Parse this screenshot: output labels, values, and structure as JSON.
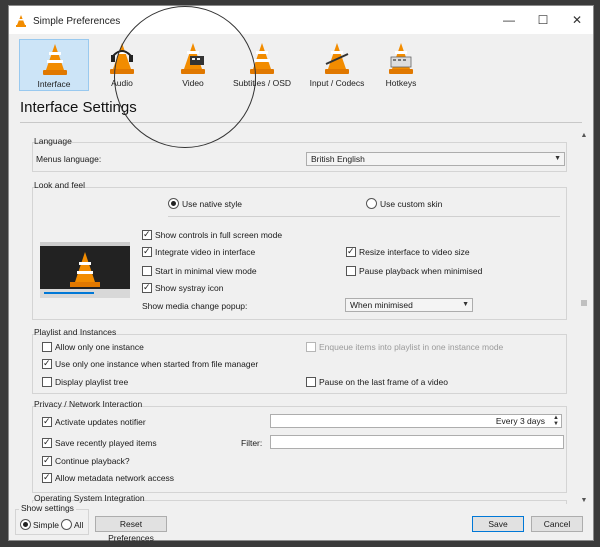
{
  "window": {
    "title": "Simple Preferences",
    "minimize": "—",
    "maximize": "☐",
    "close": "✕"
  },
  "toolbar": {
    "items": [
      {
        "label": "Interface",
        "icon": "interface-cone-icon"
      },
      {
        "label": "Audio",
        "icon": "audio-cone-icon"
      },
      {
        "label": "Video",
        "icon": "video-cone-icon"
      },
      {
        "label": "Subtitles / OSD",
        "icon": "subtitles-cone-icon"
      },
      {
        "label": "Input / Codecs",
        "icon": "codecs-cone-icon"
      },
      {
        "label": "Hotkeys",
        "icon": "hotkeys-cone-icon"
      }
    ]
  },
  "page_heading": "Interface Settings",
  "language": {
    "title": "Language",
    "menus_language_label": "Menus language:",
    "menus_language_value": "British English"
  },
  "look_and_feel": {
    "title": "Look and feel",
    "native_style": "Use native style",
    "custom_skin": "Use custom skin",
    "show_controls_fullscreen": "Show controls in full screen mode",
    "integrate_video": "Integrate video in interface",
    "resize_interface": "Resize interface to video size",
    "start_minimal": "Start in minimal view mode",
    "pause_minimised": "Pause playback when minimised",
    "show_systray": "Show systray icon",
    "media_change_popup_label": "Show media change popup:",
    "media_change_popup_value": "When minimised"
  },
  "playlist": {
    "title": "Playlist and Instances",
    "allow_one_instance": "Allow only one instance",
    "enqueue_items": "Enqueue items into playlist in one instance mode",
    "one_instance_file_manager": "Use only one instance when started from file manager",
    "display_playlist_tree": "Display playlist tree",
    "pause_last_frame": "Pause on the last frame of a video"
  },
  "privacy": {
    "title": "Privacy / Network Interaction",
    "activate_updates": "Activate updates notifier",
    "updates_interval": "Every 3 days",
    "save_recently_played": "Save recently played items",
    "filter_label": "Filter:",
    "continue_playback": "Continue playback?",
    "allow_metadata": "Allow metadata network access"
  },
  "os_integration": {
    "title": "Operating System Integration"
  },
  "footer": {
    "show_settings_label": "Show settings",
    "simple": "Simple",
    "all": "All",
    "reset": "Reset Preferences",
    "save": "Save",
    "cancel": "Cancel"
  },
  "colors": {
    "accent": "#0078d7",
    "active_tab": "#cce4f7",
    "cone_orange": "#f28c00"
  }
}
